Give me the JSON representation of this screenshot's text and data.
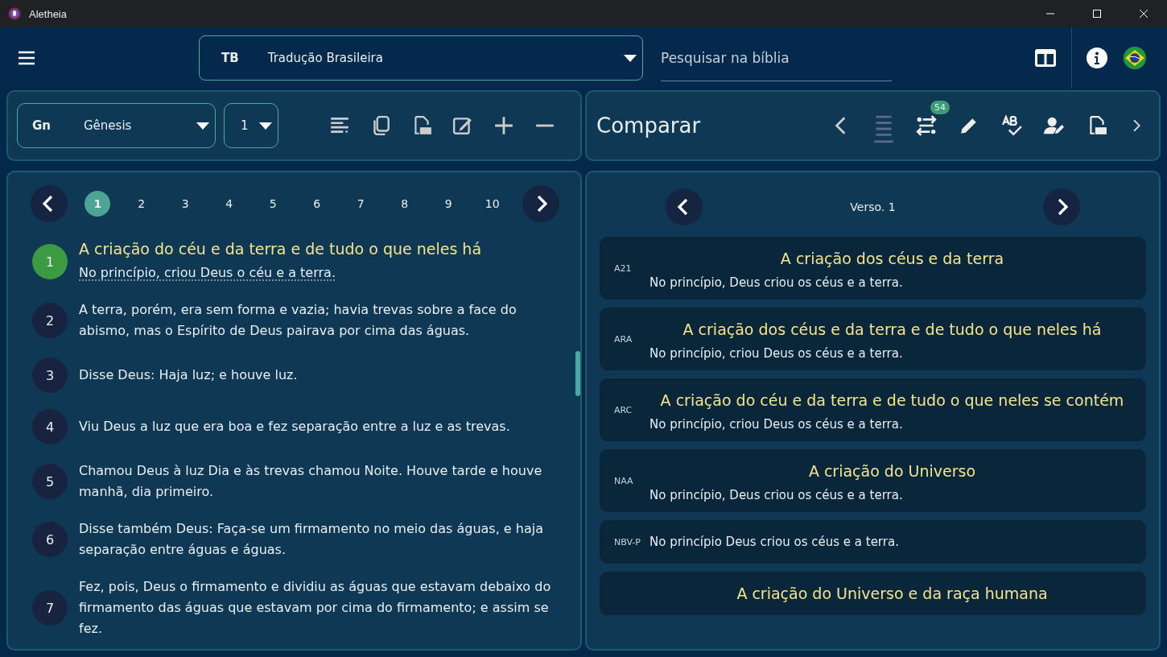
{
  "window": {
    "title": "Aletheia"
  },
  "header": {
    "translation_code": "TB",
    "translation_name": "Tradução Brasileira",
    "search_placeholder": "Pesquisar na bíblia"
  },
  "book": {
    "abbr": "Gn",
    "name": "Gênesis",
    "chapter": "1"
  },
  "chapters": [
    {
      "label": "1",
      "selected": true
    },
    {
      "label": "2",
      "selected": false
    },
    {
      "label": "3",
      "selected": false
    },
    {
      "label": "4",
      "selected": false
    },
    {
      "label": "5",
      "selected": false
    },
    {
      "label": "6",
      "selected": false
    },
    {
      "label": "7",
      "selected": false
    },
    {
      "label": "8",
      "selected": false
    },
    {
      "label": "9",
      "selected": false
    },
    {
      "label": "10",
      "selected": false
    }
  ],
  "verses": [
    {
      "number": "1",
      "heading": "A criação do céu e da terra e de tudo o que neles há",
      "text": "No princípio, criou Deus o céu e a terra.",
      "selected": true
    },
    {
      "number": "2",
      "text": "A terra, porém, era sem forma e vazia; havia trevas sobre a face do abismo, mas o Espírito de Deus pairava por cima das águas.",
      "selected": false
    },
    {
      "number": "3",
      "text": "Disse Deus: Haja luz; e houve luz.",
      "selected": false
    },
    {
      "number": "4",
      "text": "Viu Deus a luz que era boa e fez separação entre a luz e as trevas.",
      "selected": false
    },
    {
      "number": "5",
      "text": "Chamou Deus à luz Dia e às trevas chamou Noite. Houve tarde e houve manhã, dia primeiro.",
      "selected": false
    },
    {
      "number": "6",
      "text": "Disse também Deus: Faça-se um firmamento no meio das águas, e haja separação entre águas e águas.",
      "selected": false
    },
    {
      "number": "7",
      "text": "Fez, pois, Deus o firmamento e dividiu as águas que estavam debaixo do firmamento das águas que estavam por cima do firmamento; e assim se fez.",
      "selected": false
    }
  ],
  "compare": {
    "title": "Comparar",
    "badge": "54",
    "verse_label": "Verso. 1",
    "items": [
      {
        "version": "A21",
        "heading": "A criação dos céus e da terra",
        "text": "No princípio, Deus criou os céus e a terra."
      },
      {
        "version": "ARA",
        "heading": "A criação dos céus e da terra e de tudo o que neles há",
        "text": "No princípio, criou Deus os céus e a terra."
      },
      {
        "version": "ARC",
        "heading": "A criação do céu e da terra e de tudo o que neles se contém",
        "text": "No princípio, criou Deus os céus e a terra."
      },
      {
        "version": "NAA",
        "heading": "A criação do Universo",
        "text": "No princípio, Deus criou os céus e a terra."
      },
      {
        "version": "NBV-P",
        "text": "No princípio Deus criou os céus e a terra."
      },
      {
        "heading": "A criação do Universo e da raça humana"
      }
    ]
  }
}
